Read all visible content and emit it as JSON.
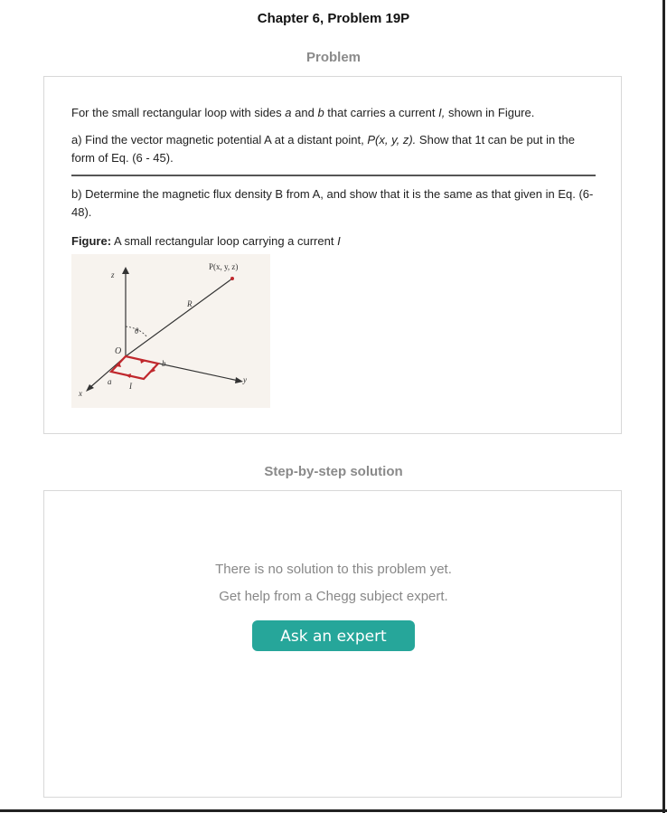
{
  "header": {
    "title": "Chapter 6, Problem 19P"
  },
  "problem": {
    "heading": "Problem",
    "intro_pre": "For the small rectangular loop with sides ",
    "intro_a": "a",
    "intro_and": " and ",
    "intro_b": "b",
    "intro_mid": " that carries a current ",
    "intro_I": "I,",
    "intro_post": " shown in Figure.",
    "part_a_pre": "a) Find the vector magnetic potential A at a distant point, ",
    "part_a_point": "P(x, y, z).",
    "part_a_post": " Show that 1t can be put in the form of Eq. (6 - 45).",
    "part_b": "b) Determine the magnetic flux density B from A, and show that it is the same as that given in Eq. (6-48).",
    "figure_label": "Figure:",
    "figure_caption_pre": " A small rectangular loop carrying a current ",
    "figure_caption_I": "I",
    "figure": {
      "point_label": "P(x, y, z)",
      "z_label": "z",
      "x_label": "x",
      "y_label": "y",
      "r_label": "R",
      "theta_label": "θ",
      "origin_label": "O",
      "a_label": "a",
      "b_label": "b",
      "i_label": "I",
      "loop_color": "#c0282d"
    }
  },
  "solution": {
    "heading": "Step-by-step solution",
    "empty_message": "There is no solution to this problem yet.",
    "help_message": "Get help from a Chegg subject expert.",
    "ask_button_label": "Ask an expert",
    "button_color": "#26a69a"
  }
}
